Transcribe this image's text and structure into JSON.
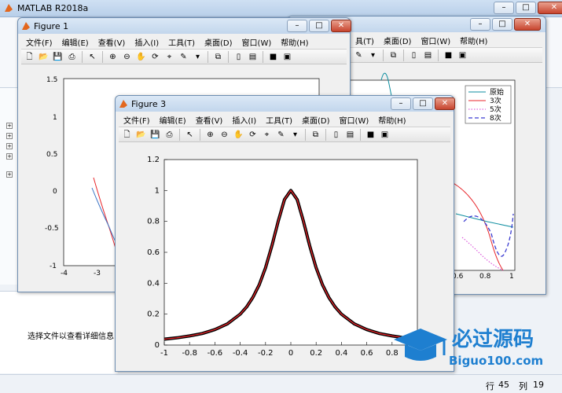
{
  "matlab": {
    "title": "MATLAB R2018a",
    "detail_text": "选择文件以查看详细信息",
    "status": {
      "row_label": "行",
      "row": "45",
      "col_label": "列",
      "col": "19"
    }
  },
  "figure1": {
    "title": "Figure 1",
    "menu": [
      "文件(F)",
      "编辑(E)",
      "查看(V)",
      "插入(I)",
      "工具(T)",
      "桌面(D)",
      "窗口(W)",
      "帮助(H)"
    ],
    "yticks": [
      "1.5",
      "1",
      "0.5",
      "0",
      "-0.5",
      "-1"
    ],
    "xticks": [
      "-4",
      "-3"
    ]
  },
  "figure2": {
    "menu_visible": [
      "具(T)",
      "桌面(D)",
      "窗口(W)",
      "帮助(H)"
    ],
    "legend": [
      {
        "label": "原始",
        "color": "#0e8ea0",
        "dash": "solid"
      },
      {
        "label": "3次",
        "color": "#e8262b",
        "dash": "solid"
      },
      {
        "label": "5次",
        "color": "#d63cd6",
        "dash": "dotted"
      },
      {
        "label": "8次",
        "color": "#3b3bd1",
        "dash": "dashed"
      }
    ],
    "xticks": [
      "0.6",
      "0.8",
      "1"
    ]
  },
  "figure3": {
    "title": "Figure 3",
    "menu": [
      "文件(F)",
      "编辑(E)",
      "查看(V)",
      "插入(I)",
      "工具(T)",
      "桌面(D)",
      "窗口(W)",
      "帮助(H)"
    ]
  },
  "chart_data": {
    "type": "line",
    "xlim": [
      -1,
      1
    ],
    "ylim": [
      0,
      1.2
    ],
    "xticks": [
      -1,
      -0.8,
      -0.6,
      -0.4,
      -0.2,
      0,
      0.2,
      0.4,
      0.6,
      0.8,
      1
    ],
    "yticks": [
      0,
      0.2,
      0.4,
      0.6,
      0.8,
      1,
      1.2
    ],
    "series": [
      {
        "color": "#000000",
        "x": [
          -1,
          -0.9,
          -0.8,
          -0.7,
          -0.6,
          -0.5,
          -0.4,
          -0.35,
          -0.3,
          -0.25,
          -0.2,
          -0.15,
          -0.1,
          -0.05,
          0,
          0.05,
          0.1,
          0.15,
          0.2,
          0.25,
          0.3,
          0.35,
          0.4,
          0.5,
          0.6,
          0.7,
          0.8,
          0.9,
          1
        ],
        "y": [
          0.038,
          0.047,
          0.059,
          0.075,
          0.1,
          0.138,
          0.2,
          0.246,
          0.308,
          0.39,
          0.5,
          0.64,
          0.8,
          0.941,
          1,
          0.941,
          0.8,
          0.64,
          0.5,
          0.39,
          0.308,
          0.246,
          0.2,
          0.138,
          0.1,
          0.075,
          0.059,
          0.047,
          0.038
        ]
      },
      {
        "color": "#e8262b",
        "x": [
          -1,
          -0.9,
          -0.8,
          -0.7,
          -0.6,
          -0.5,
          -0.4,
          -0.35,
          -0.3,
          -0.25,
          -0.2,
          -0.15,
          -0.1,
          -0.05,
          0,
          0.05,
          0.1,
          0.15,
          0.2,
          0.25,
          0.3,
          0.35,
          0.4,
          0.5,
          0.6,
          0.7,
          0.8,
          0.9,
          1
        ],
        "y": [
          0.038,
          0.047,
          0.059,
          0.075,
          0.1,
          0.138,
          0.2,
          0.246,
          0.308,
          0.39,
          0.5,
          0.64,
          0.8,
          0.941,
          1,
          0.941,
          0.8,
          0.64,
          0.5,
          0.39,
          0.308,
          0.246,
          0.2,
          0.138,
          0.1,
          0.075,
          0.059,
          0.047,
          0.038
        ]
      }
    ]
  },
  "brand": {
    "name": "必过源码",
    "url": "Biguo100.com"
  }
}
